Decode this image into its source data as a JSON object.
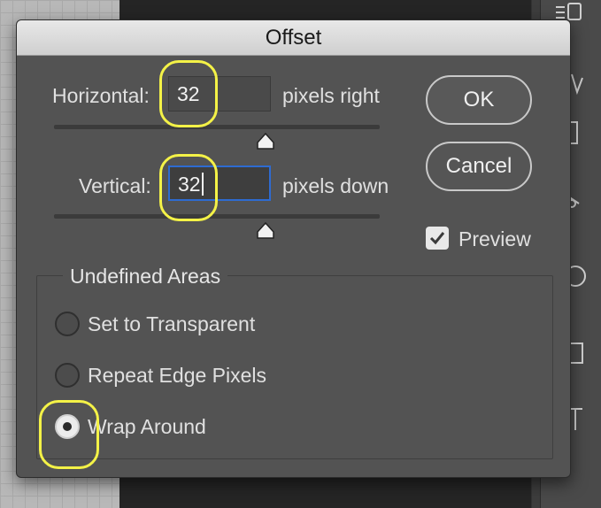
{
  "dialog": {
    "title": "Offset",
    "horizontal": {
      "label": "Horizontal:",
      "value": "32",
      "unit_label": "pixels right",
      "slider_position": 0.5
    },
    "vertical": {
      "label": "Vertical:",
      "value": "32",
      "unit_label": "pixels down",
      "slider_position": 0.5
    },
    "buttons": {
      "ok_label": "OK",
      "cancel_label": "Cancel"
    },
    "preview": {
      "label": "Preview",
      "checked": true
    },
    "undefined_areas": {
      "title": "Undefined Areas",
      "options": [
        {
          "label": "Set to Transparent",
          "selected": false
        },
        {
          "label": "Repeat Edge Pixels",
          "selected": false
        },
        {
          "label": "Wrap Around",
          "selected": true
        }
      ]
    }
  },
  "colors": {
    "dialog_bg": "#535353",
    "titlebar": "#d9d9d9",
    "focus_ring": "#2e6bd1",
    "highlight_annotation": "#f4f247"
  }
}
